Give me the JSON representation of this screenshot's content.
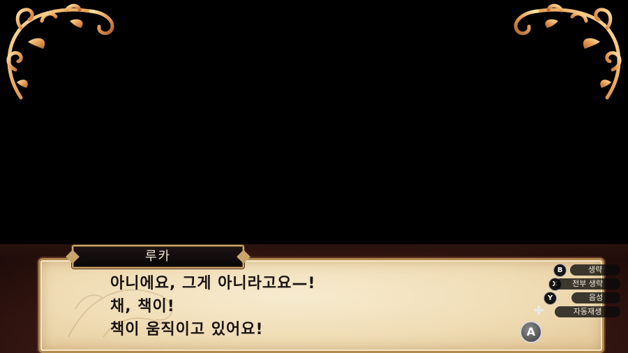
{
  "speaker": "루카",
  "dialogue": {
    "line1": "아니에요, 그게 아니라고요—!",
    "line2": "채, 책이!",
    "line3": "책이 움직이고 있어요!"
  },
  "controls": [
    {
      "button": "B",
      "label": "생략",
      "icon": "b-button-icon"
    },
    {
      "button": "X",
      "label": "전부 생략",
      "icon": "x-button-icon"
    },
    {
      "button": "Y",
      "label": "음성",
      "icon": "y-button-icon"
    },
    {
      "button": "✚",
      "label": "자동재생",
      "icon": "dpad-icon"
    }
  ],
  "advance_button": "A",
  "colors": {
    "background": "#000000",
    "parchment": "#efdcb4",
    "gold_trim": "#c9a46a",
    "frame": "#3a1812",
    "text": "#1a1410"
  }
}
